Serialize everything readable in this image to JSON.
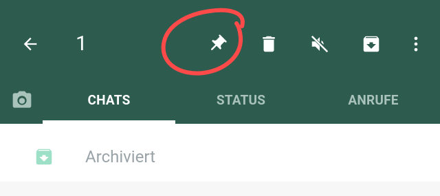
{
  "header": {
    "selected_count": "1",
    "icons": {
      "back": "arrow-left-icon",
      "pin": "pin-icon",
      "delete": "trash-icon",
      "mute": "mute-icon",
      "archive": "archive-icon",
      "more": "more-vert-icon"
    },
    "annotation": "red-hand-drawn-circle-around-pin"
  },
  "tabs": {
    "camera_icon": "camera-icon",
    "items": [
      {
        "label": "CHATS",
        "active": true
      },
      {
        "label": "STATUS",
        "active": false
      },
      {
        "label": "ANRUFE",
        "active": false
      }
    ]
  },
  "archived": {
    "label": "Archiviert",
    "icon": "archive-icon"
  },
  "colors": {
    "appbar": "#2d5c4f",
    "active_tab": "#ffffff",
    "inactive_tab": "#a9c3bb",
    "archive_icon": "#9ee0c7",
    "annotation": "#ff4a4a"
  }
}
